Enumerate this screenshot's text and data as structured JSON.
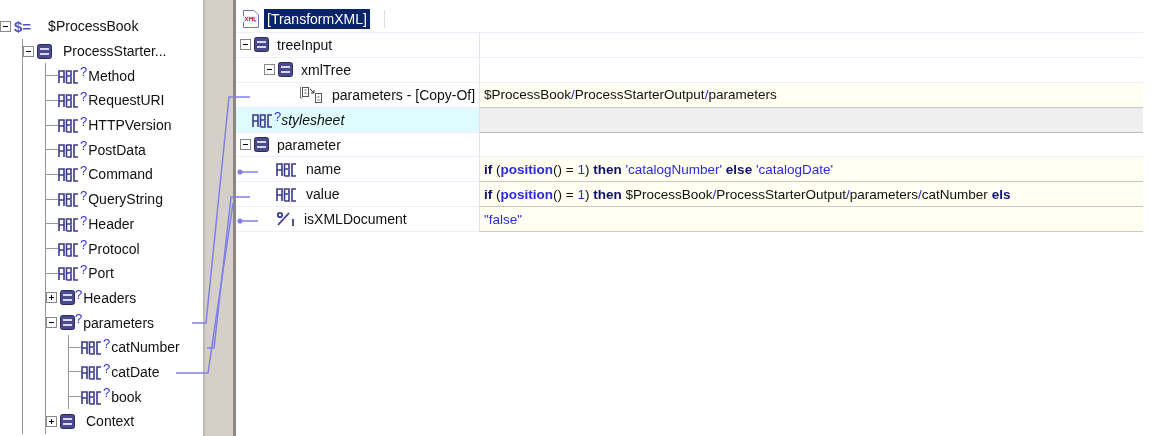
{
  "source_tree": {
    "items": [
      {
        "symbol": "$=",
        "label": "$ProcessBook",
        "expanded": true,
        "children": [
          {
            "label": "ProcessStarter...",
            "kind": "record",
            "expanded": true,
            "children": [
              {
                "label": "Method",
                "kind": "string",
                "mark": "?"
              },
              {
                "label": "RequestURI",
                "kind": "string",
                "mark": "?"
              },
              {
                "label": "HTTPVersion",
                "kind": "string",
                "mark": "?"
              },
              {
                "label": "PostData",
                "kind": "string",
                "mark": "?"
              },
              {
                "label": "Command",
                "kind": "string",
                "mark": "?"
              },
              {
                "label": "QueryString",
                "kind": "string",
                "mark": "?"
              },
              {
                "label": "Header",
                "kind": "string",
                "mark": "?"
              },
              {
                "label": "Protocol",
                "kind": "string",
                "mark": "?"
              },
              {
                "label": "Port",
                "kind": "string",
                "mark": "?"
              },
              {
                "label": "Headers",
                "kind": "record",
                "mark": "?",
                "expanded": false
              },
              {
                "label": "parameters",
                "kind": "record",
                "mark": "?",
                "expanded": true,
                "children": [
                  {
                    "label": "catNumber",
                    "kind": "string",
                    "mark": "?"
                  },
                  {
                    "label": "catDate",
                    "kind": "string",
                    "mark": "?"
                  },
                  {
                    "label": "book",
                    "kind": "string",
                    "mark": "?"
                  }
                ]
              },
              {
                "label": "Context",
                "kind": "record",
                "expanded": false
              }
            ]
          }
        ]
      }
    ]
  },
  "mapper": {
    "header": {
      "label": "[TransformXML]",
      "selected": true
    },
    "rows": [
      {
        "label": "treeInput",
        "kind": "record",
        "expanded": true,
        "selected": false,
        "children": [
          {
            "label": "xmlTree",
            "kind": "record",
            "expanded": true,
            "selected": false,
            "children": [
              {
                "label": "parameters - [Copy-Of]",
                "kind": "copy-of",
                "selected": false,
                "value": [
                  {
                    "text": "$ProcessBook",
                    "kind": "text"
                  },
                  {
                    "text": "/",
                    "kind": "op"
                  },
                  {
                    "text": "ProcessStarterOutput",
                    "kind": "text"
                  },
                  {
                    "text": "/",
                    "kind": "op"
                  },
                  {
                    "text": "parameters",
                    "kind": "text"
                  }
                ]
              }
            ]
          }
        ]
      },
      {
        "label": "stylesheet",
        "kind": "string",
        "mark": "?",
        "italic": true,
        "selected": true
      },
      {
        "label": "parameter",
        "kind": "record",
        "expanded": true,
        "selected": false,
        "children": [
          {
            "label": "name",
            "kind": "string",
            "selected": false,
            "value": [
              {
                "text": "if",
                "kind": "keyword"
              },
              {
                "text": " (",
                "kind": "text"
              },
              {
                "text": "position",
                "kind": "function"
              },
              {
                "text": "() = ",
                "kind": "text"
              },
              {
                "text": "1",
                "kind": "number"
              },
              {
                "text": ") ",
                "kind": "text"
              },
              {
                "text": "then",
                "kind": "keyword"
              },
              {
                "text": " 'catalogNumber'",
                "kind": "string"
              },
              {
                "text": " else",
                "kind": "keyword"
              },
              {
                "text": " 'catalogDate'",
                "kind": "string"
              }
            ]
          },
          {
            "label": "value",
            "kind": "string",
            "selected": false,
            "value": [
              {
                "text": "if",
                "kind": "keyword"
              },
              {
                "text": " (",
                "kind": "text"
              },
              {
                "text": "position",
                "kind": "function"
              },
              {
                "text": "() = ",
                "kind": "text"
              },
              {
                "text": "1",
                "kind": "number"
              },
              {
                "text": ") ",
                "kind": "text"
              },
              {
                "text": "then",
                "kind": "keyword"
              },
              {
                "text": " $ProcessBook",
                "kind": "text"
              },
              {
                "text": "/",
                "kind": "op"
              },
              {
                "text": "ProcessStarterOutput",
                "kind": "text"
              },
              {
                "text": "/",
                "kind": "op"
              },
              {
                "text": "parameters",
                "kind": "text"
              },
              {
                "text": "/",
                "kind": "op"
              },
              {
                "text": "catNumber ",
                "kind": "text"
              },
              {
                "text": "els",
                "kind": "keyword"
              }
            ]
          },
          {
            "label": "isXMLDocument",
            "kind": "boolean",
            "selected": false,
            "value": [
              {
                "text": "\"false\"",
                "kind": "string"
              }
            ]
          }
        ]
      }
    ]
  }
}
